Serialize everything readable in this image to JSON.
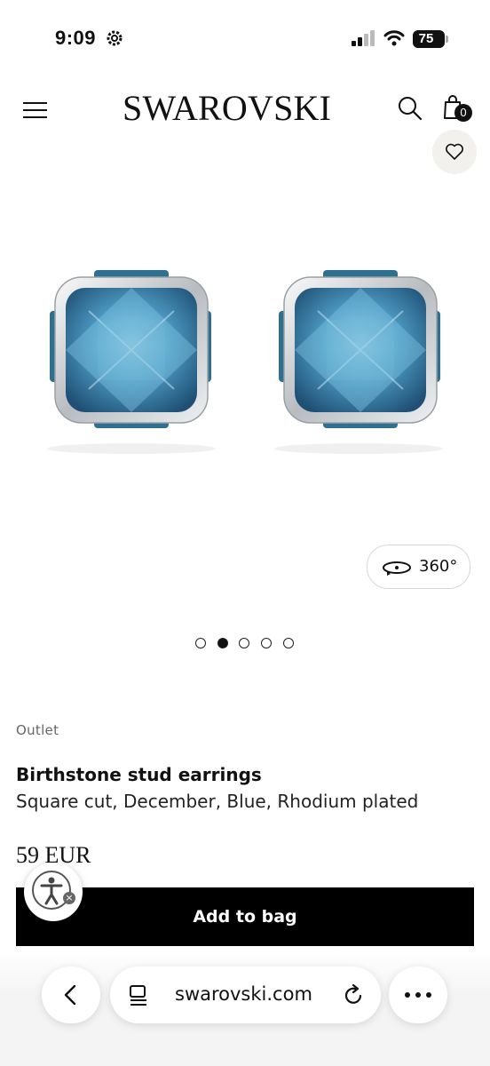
{
  "status_bar": {
    "time": "9:09",
    "battery": "75"
  },
  "header": {
    "brand": "SWAROVSKI",
    "bag_count": "0"
  },
  "gallery": {
    "view_360_label": "360°",
    "dots_total": 5,
    "active_dot_index": 1
  },
  "product": {
    "badge": "Outlet",
    "name": "Birthstone stud earrings",
    "description": "Square cut, December, Blue, Rhodium plated",
    "price": "59 EUR",
    "add_to_bag_label": "Add to bag"
  },
  "browser": {
    "url": "swarovski.com"
  },
  "colors": {
    "brand_black": "#000000",
    "crystal_blue": "#3f8fb8",
    "wish_bg": "#f3f1ee"
  }
}
